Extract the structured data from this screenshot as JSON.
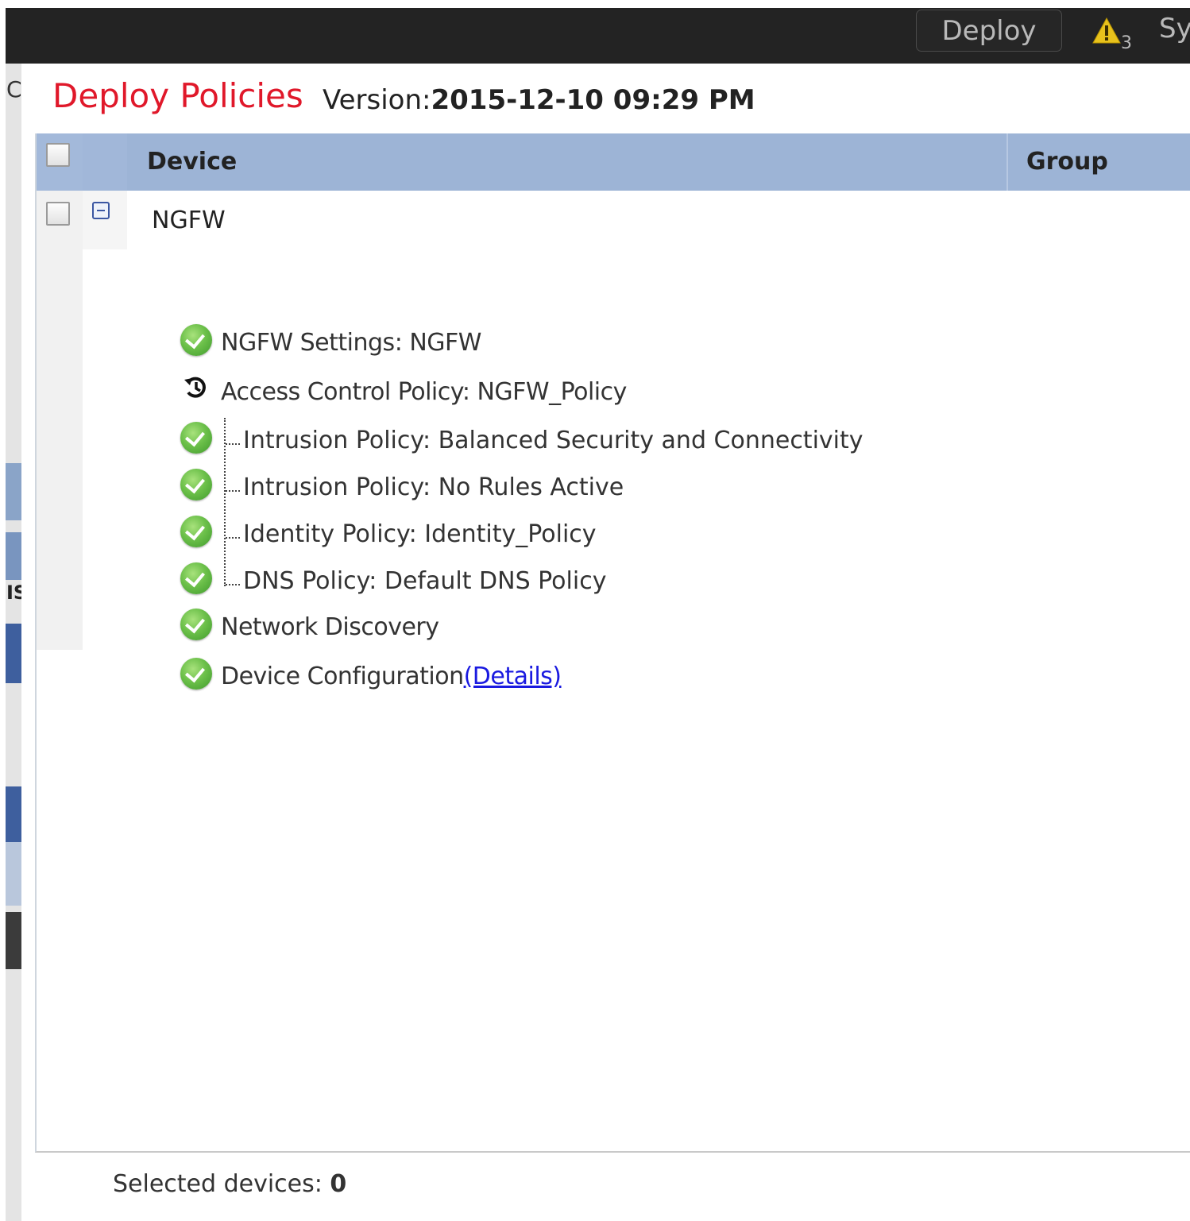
{
  "topbar": {
    "deploy_label": "Deploy",
    "alert_count": "3",
    "system_label_truncated": "Sy"
  },
  "background": {
    "truncated_letter_top": "C",
    "truncated_letter_mid": "IS"
  },
  "dialog": {
    "title": "Deploy Policies",
    "version_label": "Version:",
    "version_value": "2015-12-10 09:29 PM"
  },
  "grid": {
    "columns": [
      "Device",
      "Group"
    ],
    "device": {
      "name": "NGFW",
      "expanded": true,
      "items": [
        {
          "status": "ok",
          "label": "NGFW Settings: NGFW"
        },
        {
          "status": "history",
          "label": "Access Control Policy: NGFW_Policy"
        },
        {
          "status": "ok",
          "label": "Intrusion Policy: Balanced Security and Connectivity"
        },
        {
          "status": "ok",
          "label": "Intrusion Policy: No Rules Active"
        },
        {
          "status": "ok",
          "label": "Identity Policy: Identity_Policy"
        },
        {
          "status": "ok",
          "label": "DNS Policy: Default DNS Policy"
        },
        {
          "status": "ok",
          "label": "Network Discovery"
        },
        {
          "status": "ok",
          "label": "Device Configuration",
          "link": "(Details)"
        }
      ]
    }
  },
  "footer": {
    "selected_label": "Selected devices:",
    "selected_count": "0"
  },
  "colors": {
    "title": "#e0182a",
    "header_bar": "#232323",
    "grid_header": "#9db4d6",
    "link": "#1a1ae0",
    "ok_green": "#6cc04a"
  },
  "icons": {
    "ok": "check-circle-icon",
    "history": "history-icon",
    "warning": "warning-triangle-icon",
    "collapse": "collapse-icon"
  }
}
